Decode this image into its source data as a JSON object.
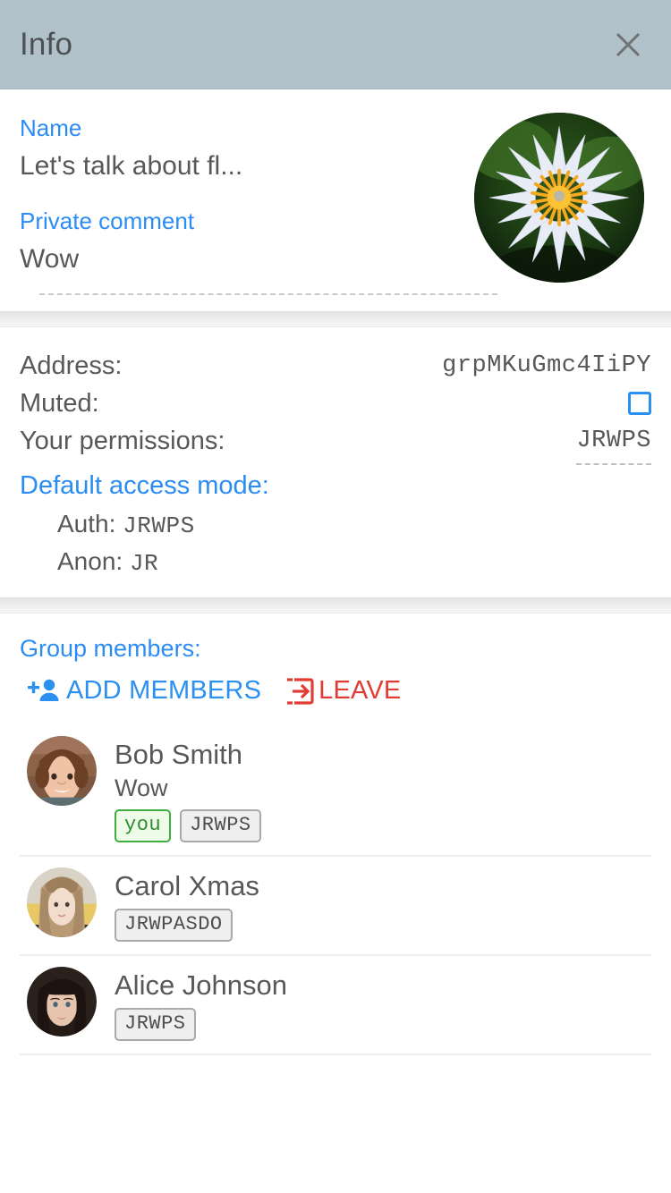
{
  "header": {
    "title": "Info",
    "close_icon": "close-icon"
  },
  "profile": {
    "name_label": "Name",
    "name_value": "Let's talk about fl...",
    "comment_label": "Private comment",
    "comment_value": "Wow",
    "avatar_icon": "flower-avatar"
  },
  "details": {
    "address_label": "Address:",
    "address_value": "grpMKuGmc4IiPY",
    "muted_label": "Muted:",
    "muted_checked": false,
    "permissions_label": "Your permissions:",
    "permissions_value": "JRWPS",
    "default_access_label": "Default access mode:",
    "auth_label": "Auth:",
    "auth_value": "JRWPS",
    "anon_label": "Anon:",
    "anon_value": "JR"
  },
  "members": {
    "title": "Group members:",
    "add_label": "ADD MEMBERS",
    "add_icon": "person-add-icon",
    "leave_label": "LEAVE",
    "leave_icon": "exit-icon",
    "list": [
      {
        "name": "Bob Smith",
        "subtitle": "Wow",
        "you_badge": "you",
        "perm_badge": "JRWPS",
        "avatar_icon": "avatar-bob"
      },
      {
        "name": "Carol Xmas",
        "subtitle": "",
        "you_badge": "",
        "perm_badge": "JRWPASDO",
        "avatar_icon": "avatar-carol"
      },
      {
        "name": "Alice Johnson",
        "subtitle": "",
        "you_badge": "",
        "perm_badge": "JRWPS",
        "avatar_icon": "avatar-alice"
      }
    ]
  },
  "colors": {
    "header_bg": "#b1c1c9",
    "link_blue": "#2b8cf4",
    "accent_blue": "#2b90f0",
    "danger_red": "#e23b33",
    "text_gray": "#58585a",
    "badge_green": "#3fae3f"
  }
}
